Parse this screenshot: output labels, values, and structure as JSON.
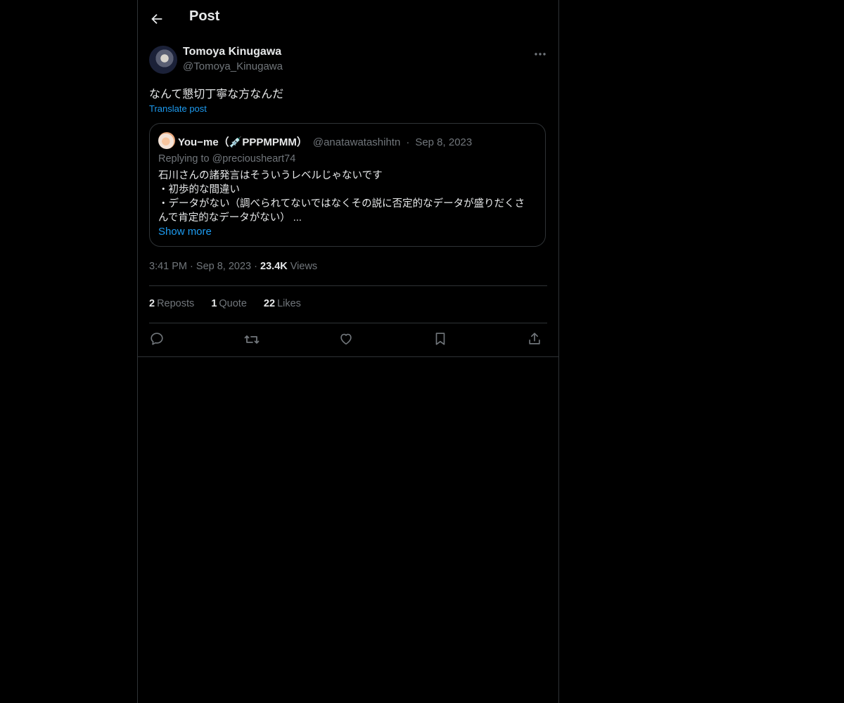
{
  "header": {
    "title": "Post"
  },
  "author": {
    "name": "Tomoya Kinugawa",
    "handle": "@Tomoya_Kinugawa"
  },
  "post": {
    "text": "なんて懇切丁寧な方なんだ",
    "translate_label": "Translate post"
  },
  "quote": {
    "name": "You−me（💉PPPMPMM）",
    "handle": "@anatawatashihtn",
    "separator": "·",
    "date": "Sep 8, 2023",
    "replying_to": "Replying to @preciousheart74",
    "lines": [
      "石川さんの諸発言はそういうレベルじゃないです",
      "・初歩的な間違い",
      "・データがない（調べられてないではなくその説に否定的なデータが盛りだくさ",
      "んで肯定的なデータがない） ..."
    ],
    "show_more": "Show more"
  },
  "meta": {
    "time": "3:41 PM",
    "separator": "·",
    "date": "Sep 8, 2023",
    "views_count": "23.4K",
    "views_label": "Views"
  },
  "stats": {
    "reposts_count": "2",
    "reposts_label": "Reposts",
    "quotes_count": "1",
    "quotes_label": "Quote",
    "likes_count": "22",
    "likes_label": "Likes"
  },
  "icons": {
    "back": "arrow-left-icon",
    "more": "more-horizontal-icon",
    "reply": "reply-icon",
    "repost": "repost-icon",
    "like": "heart-icon",
    "bookmark": "bookmark-icon",
    "share": "share-icon"
  },
  "colors": {
    "background": "#000000",
    "text": "#e7e9ea",
    "secondary": "#71767b",
    "accent": "#1d9bf0",
    "border": "#2f3336"
  }
}
